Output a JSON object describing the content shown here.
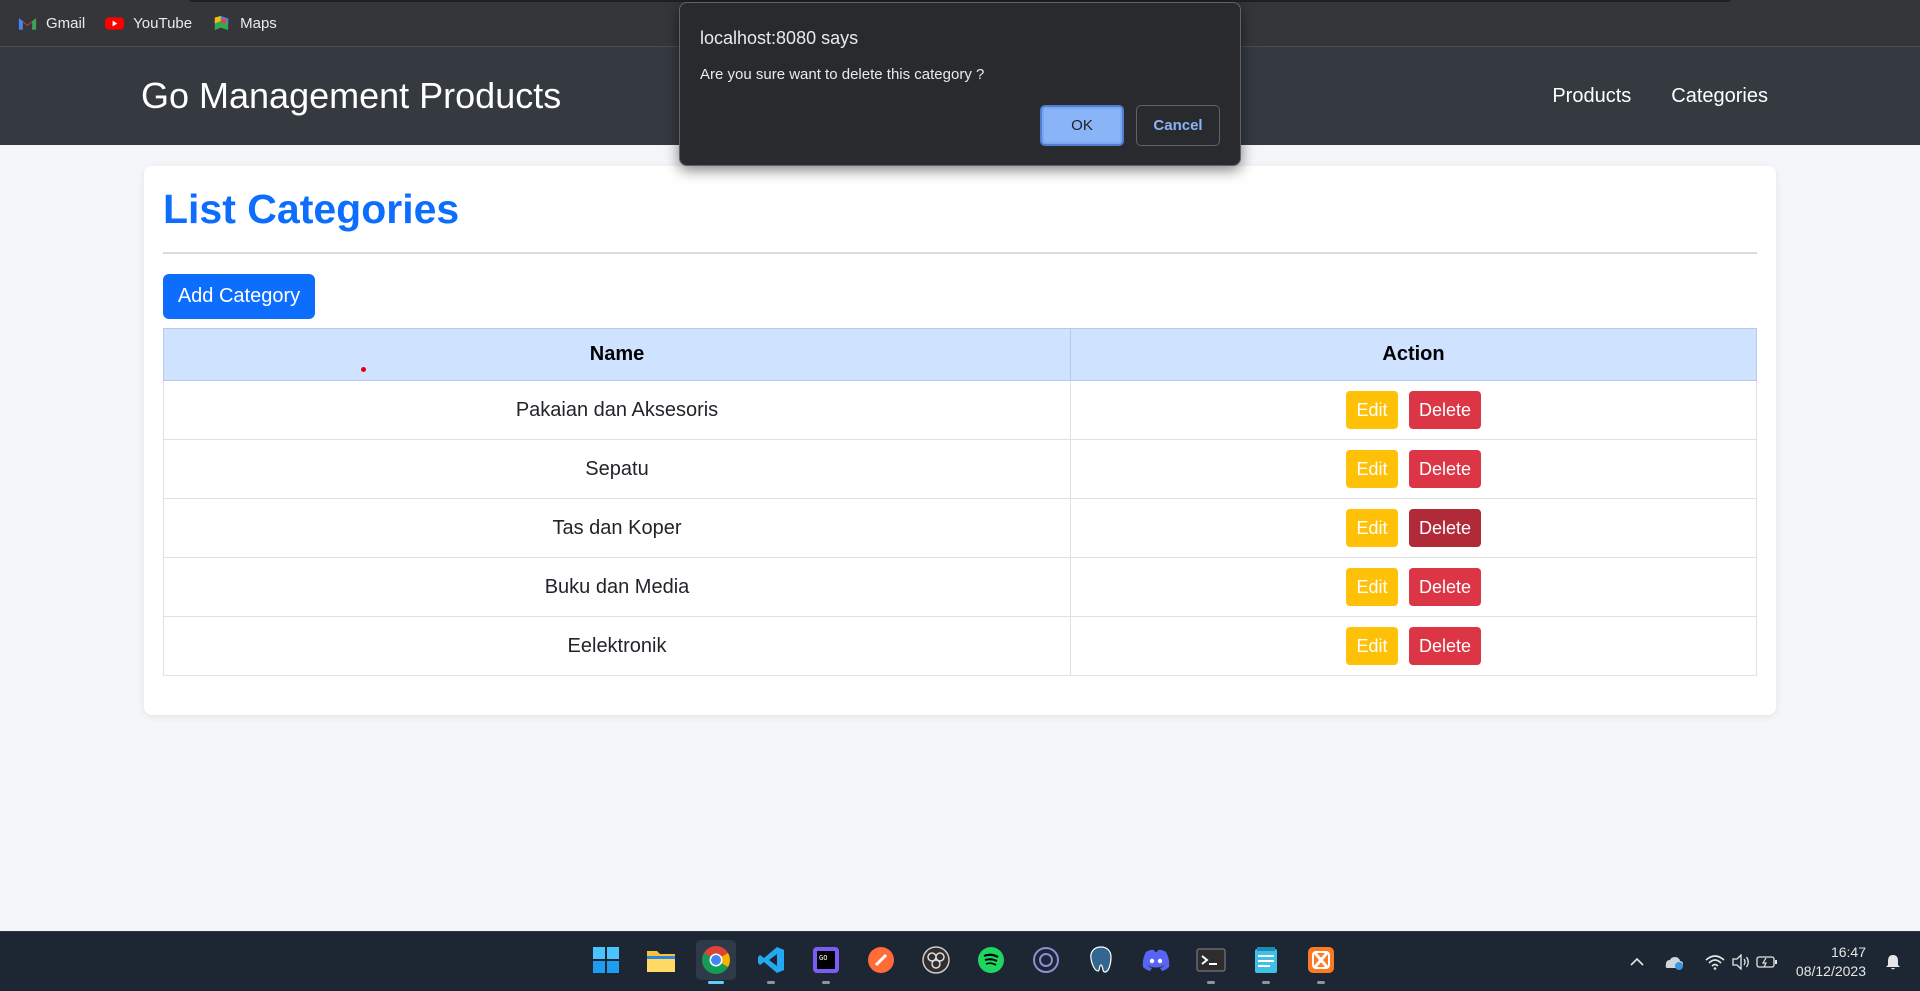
{
  "bookmarks": [
    {
      "label": "Gmail",
      "icon": "gmail-icon"
    },
    {
      "label": "YouTube",
      "icon": "youtube-icon"
    },
    {
      "label": "Maps",
      "icon": "maps-icon"
    }
  ],
  "navbar": {
    "brand": "Go Management Products",
    "links": [
      "Products",
      "Categories"
    ]
  },
  "page": {
    "title": "List Categories",
    "add_button": "Add Category",
    "table": {
      "headers": [
        "Name",
        "Action"
      ],
      "rows": [
        {
          "name": "Pakaian dan Aksesoris"
        },
        {
          "name": "Sepatu"
        },
        {
          "name": "Tas dan Koper"
        },
        {
          "name": "Buku dan Media"
        },
        {
          "name": "Eelektronik"
        }
      ],
      "edit_label": "Edit",
      "delete_label": "Delete"
    }
  },
  "dialog": {
    "title": "localhost:8080 says",
    "message": "Are you sure want to delete this category ?",
    "ok_label": "OK",
    "cancel_label": "Cancel"
  },
  "taskbar": {
    "apps": [
      "windows-start-icon",
      "file-explorer-icon",
      "chrome-icon",
      "vscode-icon",
      "goland-icon",
      "postman-icon",
      "obs-icon",
      "spotify-icon",
      "edge-browser-icon",
      "postgresql-icon",
      "discord-icon",
      "terminal-icon",
      "notepad-icon",
      "xampp-icon"
    ],
    "time": "16:47",
    "date": "08/12/2023"
  },
  "colors": {
    "primary": "#0d6efd",
    "warning": "#ffc107",
    "danger": "#dc3545",
    "navbar": "#343a40",
    "table_header": "#cfe2ff"
  }
}
